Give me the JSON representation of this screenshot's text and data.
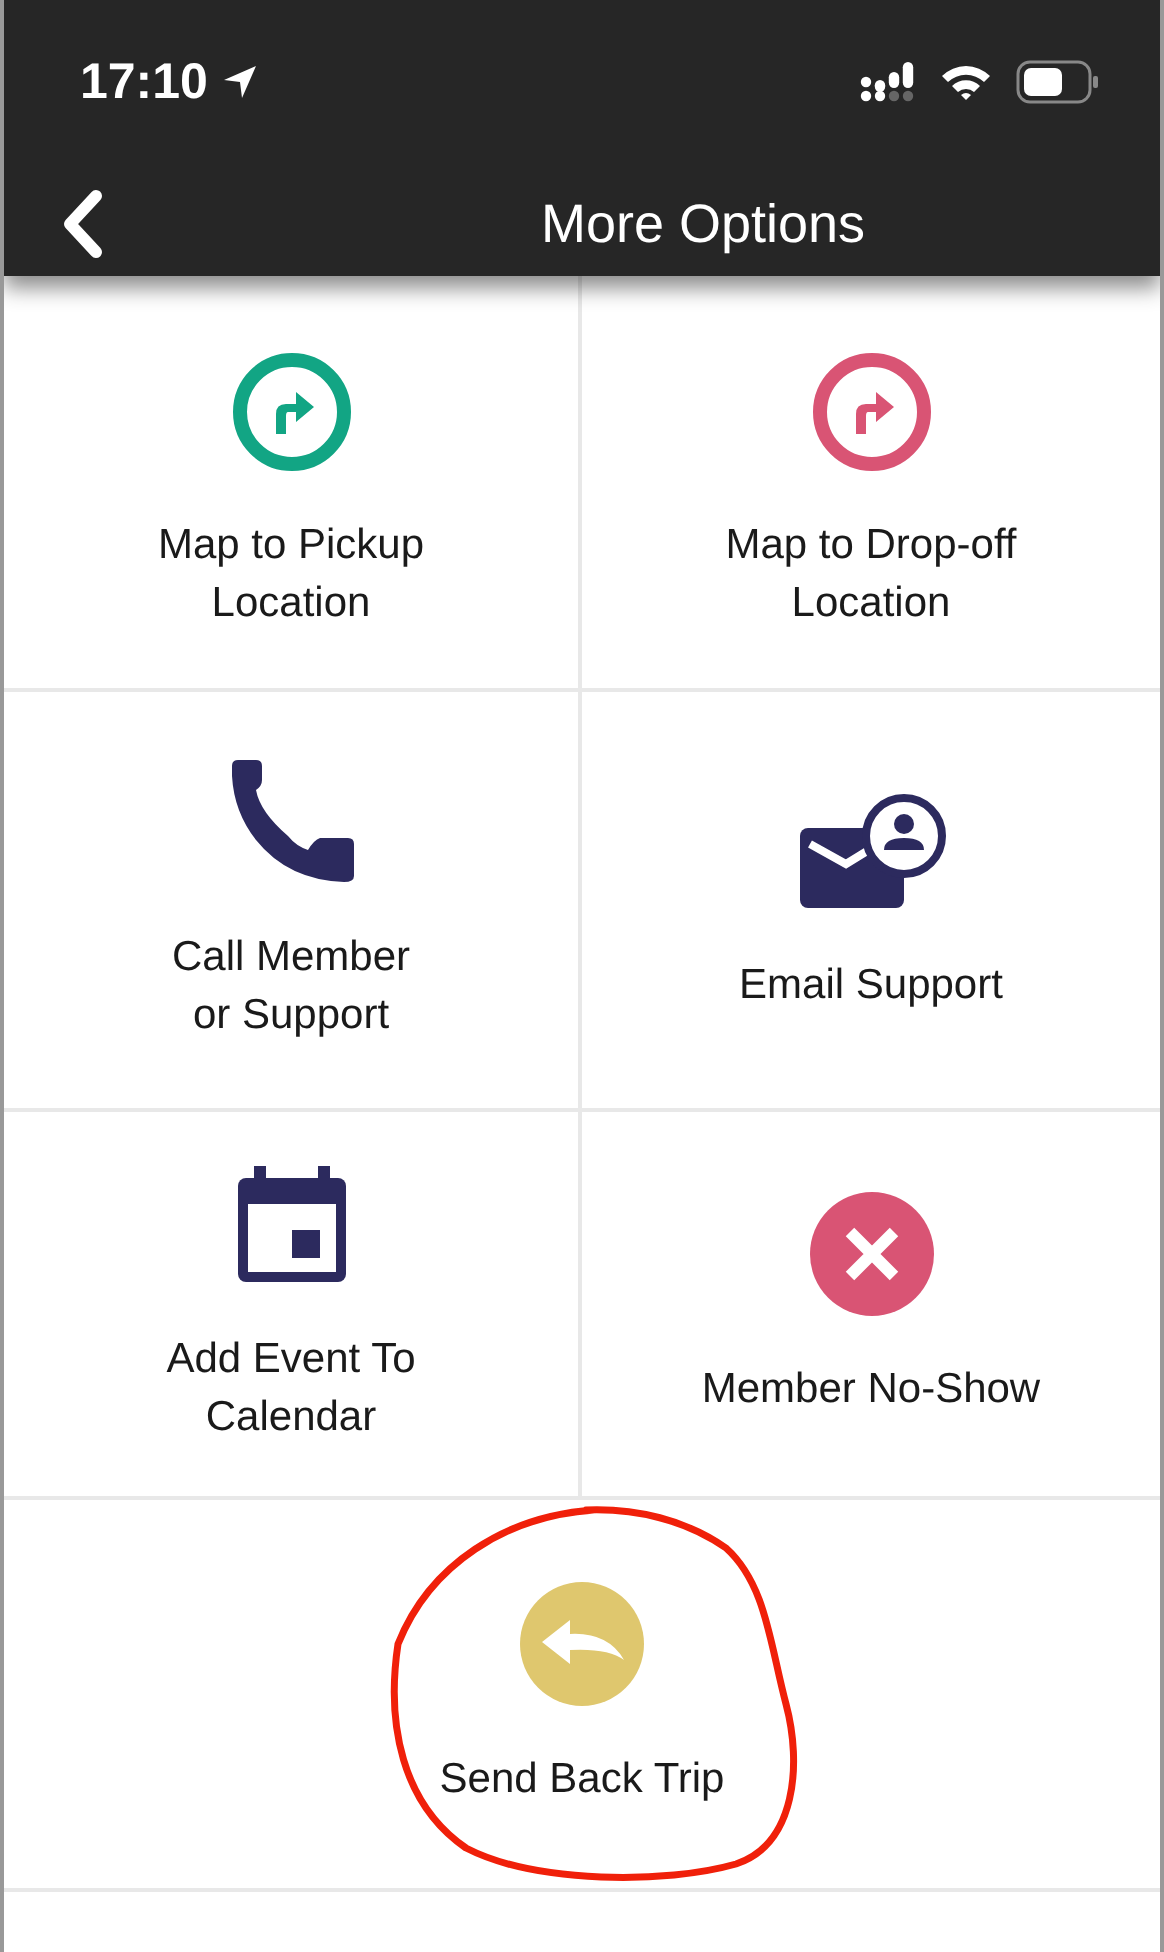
{
  "status_bar": {
    "time": "17:10"
  },
  "header": {
    "title": "More Options"
  },
  "options": [
    {
      "kind": "turn",
      "label": "Map to Pickup Location",
      "color": "#12a584",
      "highlighted": false
    },
    {
      "kind": "turn",
      "label": "Map to Drop-off Location",
      "color": "#d95474",
      "highlighted": false
    },
    {
      "kind": "phone",
      "label": "Call Member or Support",
      "color": "#2c2a5e",
      "highlighted": false
    },
    {
      "kind": "mail-person",
      "label": "Email Support",
      "color": "#2c2a5e",
      "highlighted": false
    },
    {
      "kind": "calendar",
      "label": "Add Event To Calendar",
      "color": "#2c2a5e",
      "highlighted": false
    },
    {
      "kind": "close",
      "label": "Member No-Show",
      "color": "#d95474",
      "highlighted": false
    },
    {
      "kind": "reply",
      "label": "Send Back Trip",
      "color": "#dfc76e",
      "highlighted": true
    }
  ]
}
